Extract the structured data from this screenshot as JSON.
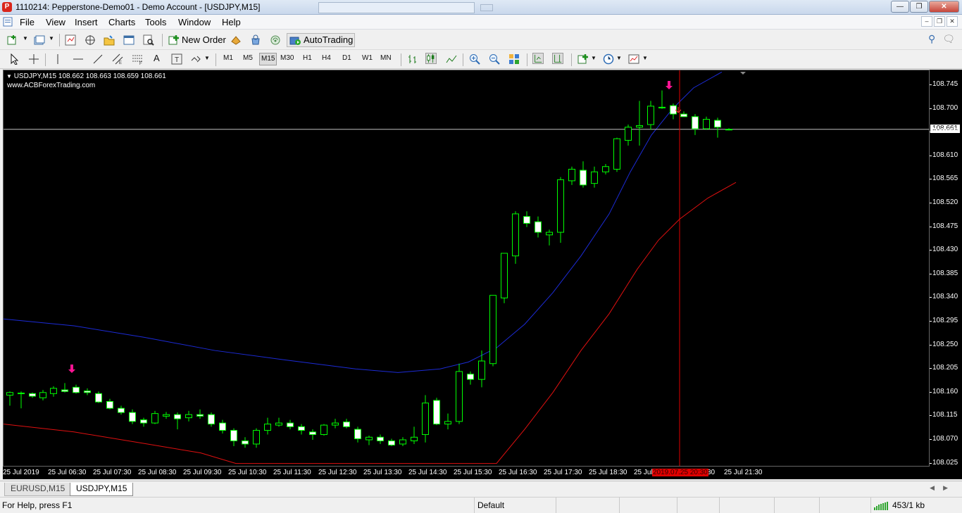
{
  "window": {
    "title": "1110214: Pepperstone-Demo01 - Demo Account - [USDJPY,M15]",
    "app_icon": "P"
  },
  "menu": [
    "File",
    "View",
    "Insert",
    "Charts",
    "Tools",
    "Window",
    "Help"
  ],
  "toolbar": {
    "new_order_label": "New Order",
    "autotrading_label": "AutoTrading",
    "timeframes": [
      "M1",
      "M5",
      "M15",
      "M30",
      "H1",
      "H4",
      "D1",
      "W1",
      "MN"
    ],
    "active_timeframe": "M15"
  },
  "chart": {
    "symbol_header": "USDJPY,M15  108.662 108.663 108.659 108.661",
    "site": "www.ACBForexTrading.com",
    "current_price": "108.661",
    "y_labels": [
      "108.745",
      "108.700",
      "108.655",
      "108.610",
      "108.565",
      "108.520",
      "108.475",
      "108.430",
      "108.385",
      "108.340",
      "108.295",
      "108.250",
      "108.205",
      "108.160",
      "108.115",
      "108.070",
      "108.025"
    ],
    "x_labels": [
      "25 Jul 2019",
      "25 Jul 06:30",
      "25 Jul 07:30",
      "25 Jul 08:30",
      "25 Jul 09:30",
      "25 Jul 10:30",
      "25 Jul 11:30",
      "25 Jul 12:30",
      "25 Jul 13:30",
      "25 Jul 14:30",
      "25 Jul 15:30",
      "25 Jul 16:30",
      "25 Jul 17:30",
      "25 Jul 18:30",
      "25 Jul",
      "30",
      "25 Jul 21:30"
    ],
    "crosshair_time": "2019.07.25 20:30",
    "colors": {
      "background": "#000000",
      "bull_candle": "#00ff00",
      "bear_candle_body": "#ffffff",
      "ma_blue": "#1c2bd6",
      "ma_red": "#e01010",
      "signal_arrow": "#ff1493"
    }
  },
  "chart_tabs": [
    "EURUSD,M15",
    "USDJPY,M15"
  ],
  "active_chart_tab": "USDJPY,M15",
  "status": {
    "help": "For Help, press F1",
    "profile": "Default",
    "traffic": "453/1 kb"
  }
}
